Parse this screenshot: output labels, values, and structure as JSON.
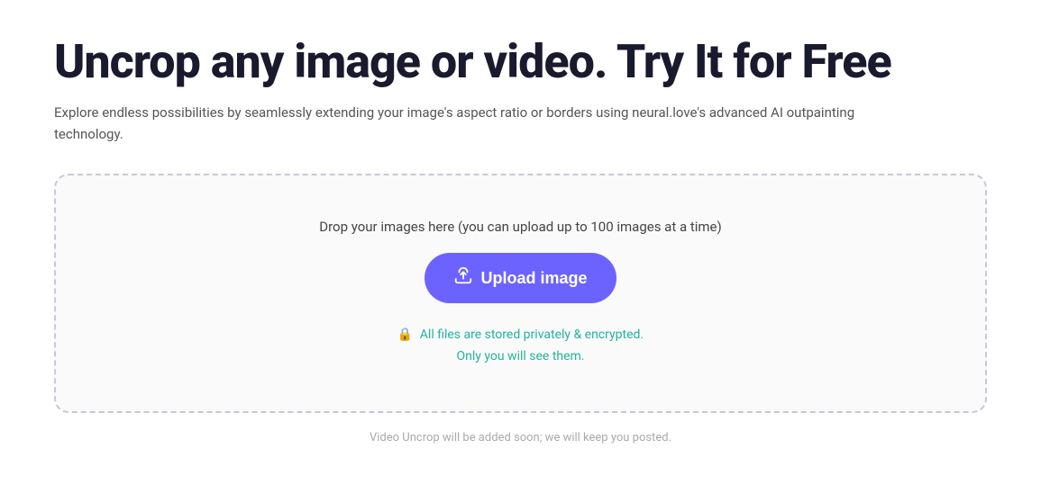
{
  "header": {
    "title": "Uncrop any image or video. Try It for Free",
    "subtitle": "Explore endless possibilities by seamlessly extending your image's aspect ratio or borders using neural.love's advanced AI outpainting technology."
  },
  "upload_zone": {
    "drop_text": "Drop your images here (you can upload up to 100 images at a time)",
    "button_label": "Upload image",
    "privacy_line1": "All files are stored privately & encrypted.",
    "privacy_line2": "Only you will see them."
  },
  "footer": {
    "note": "Video Uncrop will be added soon; we will keep you posted."
  },
  "icons": {
    "upload": "⬆",
    "lock": "🔒"
  }
}
